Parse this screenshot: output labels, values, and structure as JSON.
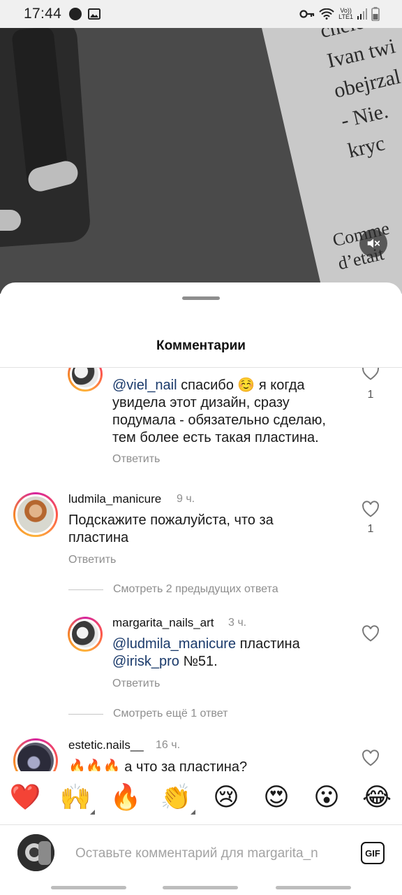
{
  "status_bar": {
    "time": "17:44",
    "net_line1": "Vo))",
    "net_line2": "LTE1"
  },
  "video": {
    "book_text": "chele\nIvan twi\nobejrzal\n- Nie. \nkryc",
    "book_text2": "Comme\nd’etait"
  },
  "sheet": {
    "title": "Комментарии"
  },
  "comments": {
    "c0": {
      "mention": "@viel_nail",
      "text_rest": " спасибо ☺️ я когда увидела этот дизайн, сразу подумала - обязательно сделаю, тем более есть такая пластина.",
      "reply": "Ответить",
      "likes": "1"
    },
    "c1": {
      "username": "ludmila_manicure",
      "time": "9 ч.",
      "text": "Подскажите пожалуйста, что за пластина",
      "reply": "Ответить",
      "likes": "1"
    },
    "view_prev": "Смотреть 2 предыдущих ответа",
    "c2": {
      "username": "margarita_nails_art",
      "time": "3 ч.",
      "mention1": "@ludmila_manicure",
      "text_mid": " пластина",
      "mention2": "@irisk_pro",
      "text_end": " №51.",
      "reply": "Ответить"
    },
    "view_more": "Смотреть ещё 1 ответ",
    "c3": {
      "username": "estetic.nails__",
      "time": "16 ч.",
      "text": "🔥🔥🔥 а что за пластина?"
    }
  },
  "emoji_bar": [
    "❤️",
    "🙌",
    "🔥",
    "👏",
    "😢",
    "😍",
    "😮",
    "😂"
  ],
  "composer": {
    "placeholder": "Оставьте комментарий для margarita_n",
    "gif_label": "GIF"
  }
}
